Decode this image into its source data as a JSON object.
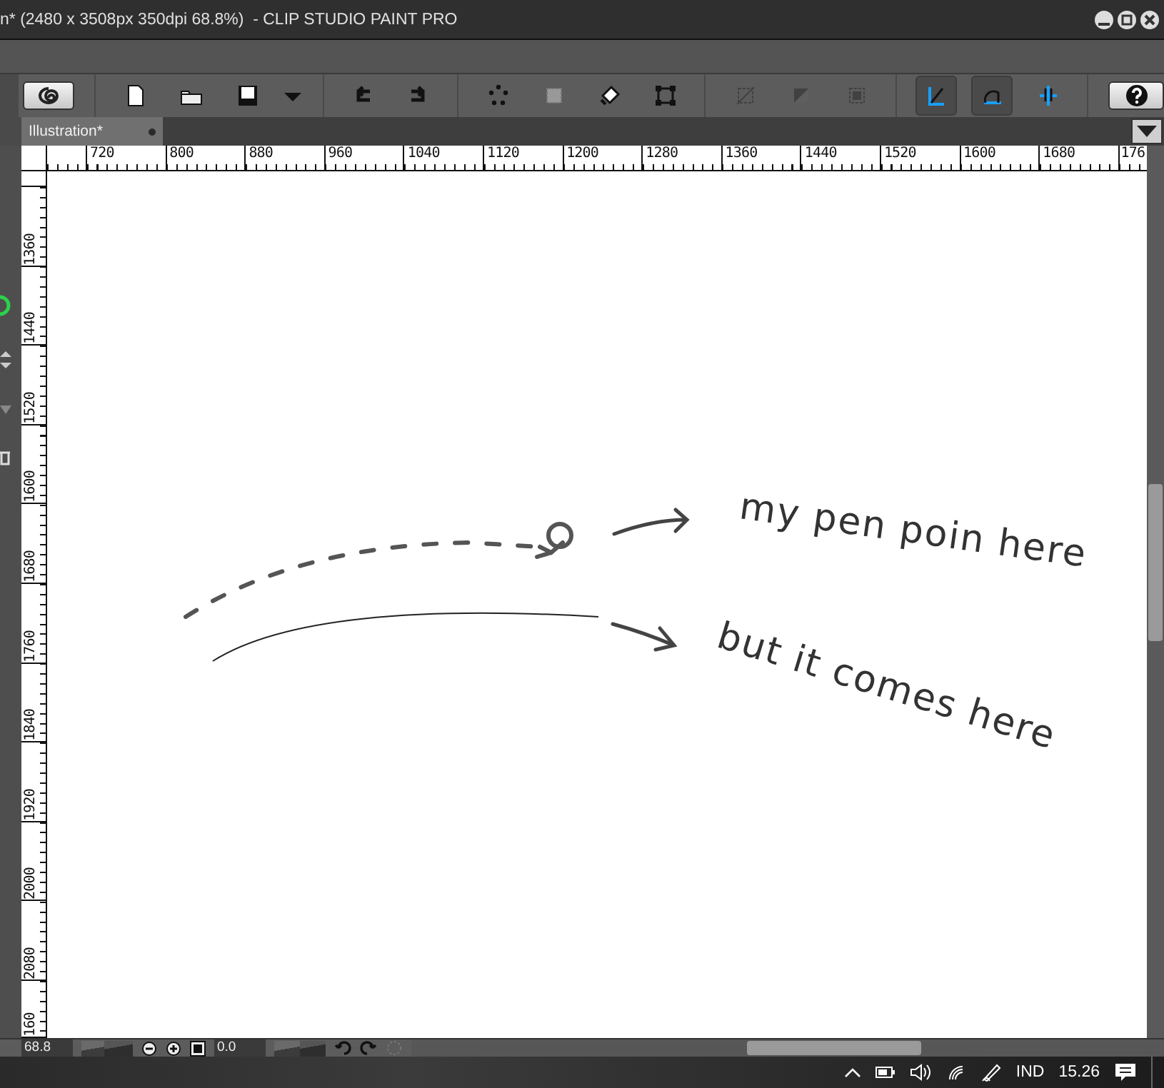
{
  "window": {
    "title": "n* (2480 x 3508px 350dpi 68.8%)  - CLIP STUDIO PAINT PRO"
  },
  "toolbar": {
    "disabled_buttons": [
      {
        "disabled": true
      },
      {
        "disabled": true
      },
      {
        "disabled": true
      }
    ],
    "snap_buttons": [
      {
        "selected": true
      },
      {
        "selected": true
      },
      {
        "selected": false
      }
    ]
  },
  "tabs": [
    {
      "label": "Illustration*",
      "selected": true
    }
  ],
  "ruler_horizontal": [
    "720",
    "800",
    "880",
    "960",
    "1040",
    "1120",
    "1200",
    "1280",
    "1360",
    "1440",
    "1520",
    "1600",
    "1680",
    "176"
  ],
  "ruler_vertical": [
    "1360",
    "1440",
    "1520",
    "1600",
    "1680",
    "1760",
    "1840",
    "1920",
    "2000",
    "2080",
    "160"
  ],
  "canvas": {
    "notes": [
      {
        "text": "my pen poin here"
      },
      {
        "text": "but it comes here"
      }
    ]
  },
  "status_bar": {
    "zoom": "68.8",
    "zoom_slider": {
      "level": 0.45
    },
    "angle": "0.0",
    "rotation_slider": {
      "level": 0.5
    }
  },
  "taskbar": {
    "language": "IND",
    "time": "15.26"
  }
}
